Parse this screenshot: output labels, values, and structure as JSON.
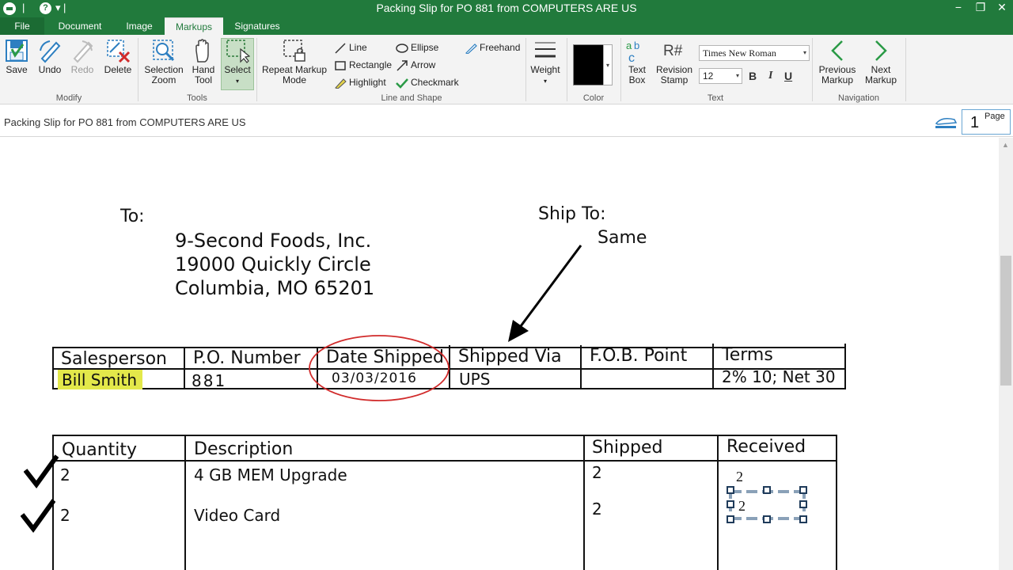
{
  "titlebar": {
    "title": "Packing Slip for PO 881 from COMPUTERS ARE US",
    "help": "?",
    "minimize": "−",
    "restore": "❐",
    "close": "✕"
  },
  "tabs": {
    "file": "File",
    "document": "Document",
    "image": "Image",
    "markups": "Markups",
    "signatures": "Signatures"
  },
  "ribbon": {
    "save": "Save",
    "undo": "Undo",
    "redo": "Redo",
    "delete": "Delete",
    "modify_group": "Modify",
    "selection_zoom_1": "Selection",
    "selection_zoom_2": "Zoom",
    "hand_tool_1": "Hand",
    "hand_tool_2": "Tool",
    "select": "Select",
    "tools_group": "Tools",
    "repeat_markup_1": "Repeat Markup",
    "repeat_markup_2": "Mode",
    "line": "Line",
    "rectangle": "Rectangle",
    "highlight": "Highlight",
    "ellipse": "Ellipse",
    "arrow": "Arrow",
    "checkmark": "Checkmark",
    "freehand": "Freehand",
    "line_shape_group": "Line and Shape",
    "weight": "Weight",
    "color_group": "Color",
    "text_box_1": "Text",
    "text_box_2": "Box",
    "revision_stamp_1": "Revision",
    "revision_stamp_2": "Stamp",
    "font_name": "Times New Roman",
    "font_size": "12",
    "bold": "B",
    "italic": "I",
    "underline": "U",
    "text_group": "Text",
    "previous_markup_1": "Previous",
    "previous_markup_2": "Markup",
    "next_markup_1": "Next",
    "next_markup_2": "Markup",
    "navigation_group": "Navigation"
  },
  "docstrip": {
    "title": "Packing Slip for PO 881 from COMPUTERS ARE US",
    "page_number": "1",
    "page_label": "Page"
  },
  "document": {
    "to_label": "To:",
    "address_line1": "9-Second Foods, Inc.",
    "address_line2": "19000 Quickly Circle",
    "address_line3": "Columbia, MO 65201",
    "ship_to_label": "Ship To:",
    "ship_to_value": "Same",
    "header_table": {
      "headers": [
        "Salesperson",
        "P.O. Number",
        "Date Shipped",
        "Shipped Via",
        "F.O.B. Point",
        "Terms"
      ],
      "values": [
        "Bill Smith",
        "881",
        "03/03/2016",
        "UPS",
        "",
        "2% 10; Net 30"
      ]
    },
    "items_table": {
      "headers": [
        "Quantity",
        "Description",
        "Shipped",
        "Received"
      ],
      "rows": [
        {
          "quantity": "2",
          "description": "4 GB MEM Upgrade",
          "shipped": "2",
          "received": "2"
        },
        {
          "quantity": "2",
          "description": "Video Card",
          "shipped": "2",
          "received": "2"
        }
      ]
    }
  },
  "colors": {
    "accent": "#217a3c",
    "highlight": "#e3e84a",
    "ellipse": "#d12b2b"
  }
}
